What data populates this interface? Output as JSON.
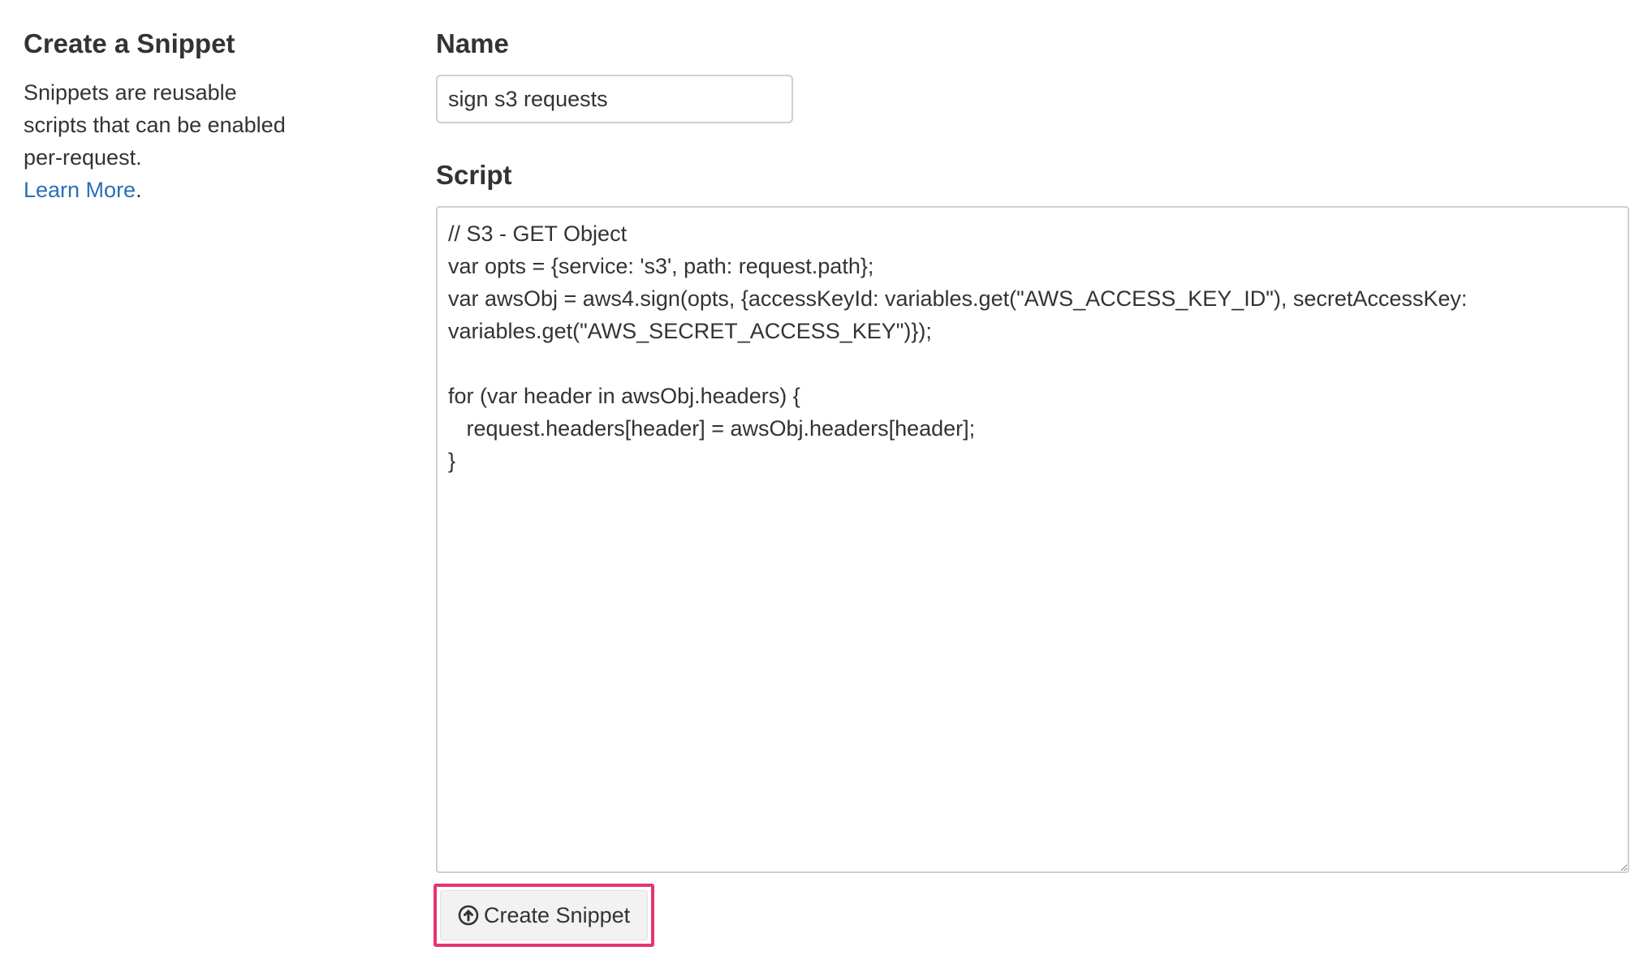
{
  "sidebar": {
    "title": "Create a Snippet",
    "description": "Snippets are reusable scripts that can be enabled per-request.",
    "learn_more": "Learn More",
    "trailing_period": "."
  },
  "form": {
    "name_label": "Name",
    "name_value": "sign s3 requests",
    "script_label": "Script",
    "script_value": "// S3 - GET Object\nvar opts = {service: 's3', path: request.path};\nvar awsObj = aws4.sign(opts, {accessKeyId: variables.get(\"AWS_ACCESS_KEY_ID\"), secretAccessKey: variables.get(\"AWS_SECRET_ACCESS_KEY\")});\n\nfor (var header in awsObj.headers) {\n   request.headers[header] = awsObj.headers[header];\n}",
    "submit_label": "Create Snippet",
    "submit_icon": "circle-arrow-up-icon"
  },
  "colors": {
    "link": "#2a6fb8",
    "highlight_border": "#e8356f",
    "text": "#333333"
  }
}
